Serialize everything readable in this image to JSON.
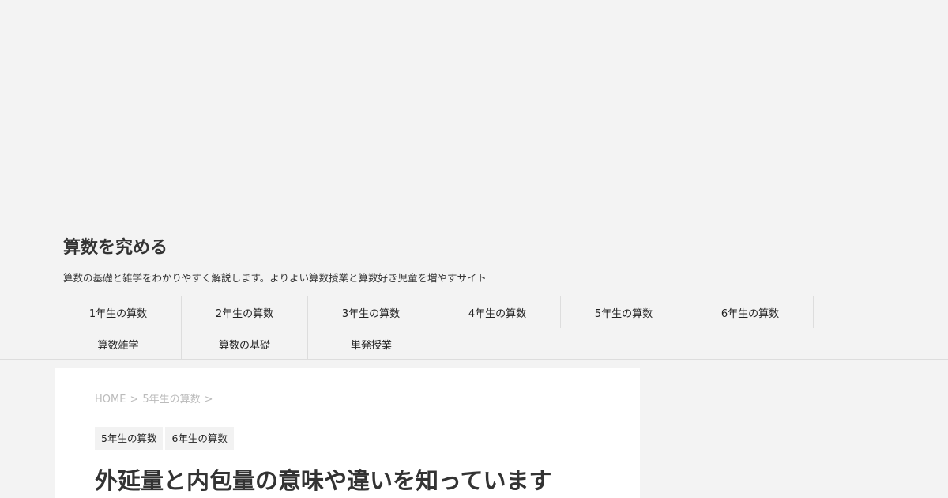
{
  "header": {
    "site_title": "算数を究める",
    "site_description": "算数の基礎と雑学をわかりやすく解説します。よりよい算数授業と算数好き児童を増やすサイト"
  },
  "nav": {
    "items": [
      {
        "label": "1年生の算数"
      },
      {
        "label": "2年生の算数"
      },
      {
        "label": "3年生の算数"
      },
      {
        "label": "4年生の算数"
      },
      {
        "label": "5年生の算数"
      },
      {
        "label": "6年生の算数"
      },
      {
        "label": "算数雑学"
      },
      {
        "label": "算数の基礎"
      },
      {
        "label": "単発授業"
      }
    ]
  },
  "breadcrumb": {
    "home": "HOME",
    "separator": ">",
    "category": "5年生の算数"
  },
  "article": {
    "tags": [
      {
        "label": "5年生の算数"
      },
      {
        "label": "6年生の算数"
      }
    ],
    "title": "外延量と内包量の意味や違いを知っています"
  }
}
